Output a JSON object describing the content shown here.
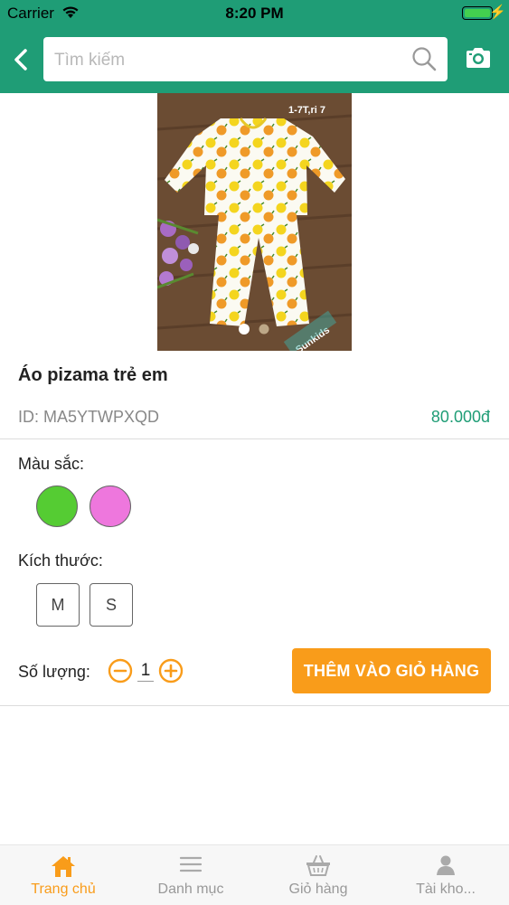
{
  "status_bar": {
    "carrier": "Carrier",
    "time": "8:20 PM"
  },
  "header": {
    "search": {
      "placeholder": "Tìm kiếm",
      "value": ""
    }
  },
  "product": {
    "image_text": {
      "size_tag": "1-7T,ri 7",
      "brand_tag": "Sunkids"
    },
    "carousel": {
      "count": 2,
      "active_index": 0
    },
    "name": "Áo pizama trẻ em",
    "id_label": "ID: MA5YTWPXQD",
    "price": "80.000đ"
  },
  "options": {
    "color_label": "Màu sắc:",
    "colors": [
      "#55cc33",
      "#ee77dd"
    ],
    "size_label": "Kích thước:",
    "sizes": [
      "M",
      "S"
    ],
    "quantity_label": "Số lượng:",
    "quantity": "1",
    "add_to_cart_label": "THÊM VÀO GIỎ HÀNG"
  },
  "tabs": [
    {
      "label": "Trang chủ",
      "icon": "home-icon",
      "active": true
    },
    {
      "label": "Danh mục",
      "icon": "menu-icon",
      "active": false
    },
    {
      "label": "Giỏ hàng",
      "icon": "basket-icon",
      "active": false
    },
    {
      "label": "Tài kho...",
      "icon": "user-icon",
      "active": false
    }
  ],
  "colors": {
    "brand": "#1f9d76",
    "accent": "#f99c1a"
  }
}
